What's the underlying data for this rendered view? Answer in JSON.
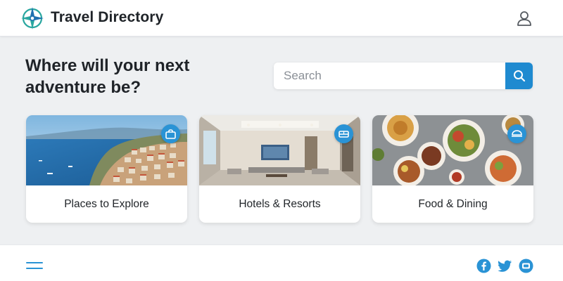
{
  "header": {
    "brand_title": "Travel Directory",
    "logo_icon": "compass-logo-icon",
    "profile_icon": "user-profile-icon"
  },
  "hero": {
    "headline": "Where will your next adventure be?"
  },
  "search": {
    "placeholder": "Search",
    "value": "",
    "button_icon": "search-icon"
  },
  "cards": [
    {
      "label": "Places to Explore",
      "badge_icon": "bag-icon",
      "image": "coastal-town-photo"
    },
    {
      "label": "Hotels & Resorts",
      "badge_icon": "bed-icon",
      "image": "hotel-lobby-photo"
    },
    {
      "label": "Food & Dining",
      "badge_icon": "dish-icon",
      "image": "food-platter-photo"
    }
  ],
  "footer": {
    "menu_icon": "hamburger-menu-icon",
    "social": [
      "facebook-icon",
      "twitter-icon",
      "chat-icon"
    ]
  },
  "colors": {
    "accent": "#1f8ad0",
    "background": "#eef0f2",
    "surface": "#ffffff",
    "text": "#1f2328"
  }
}
